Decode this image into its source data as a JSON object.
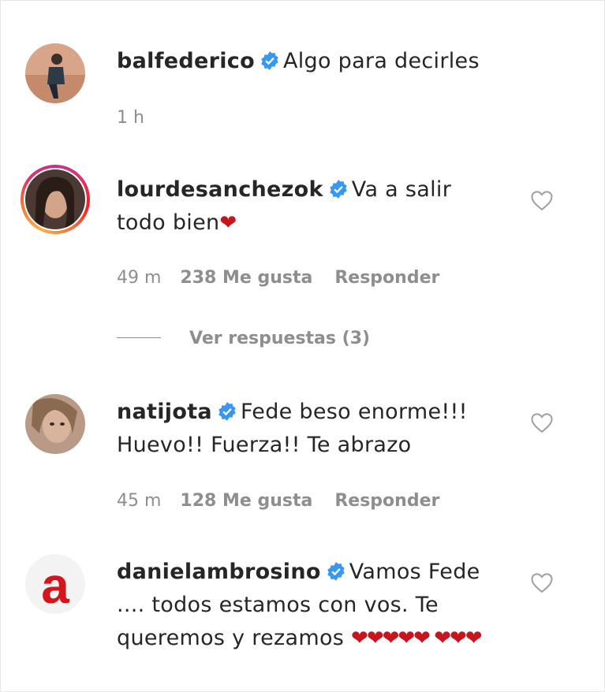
{
  "post": {
    "username": "balfederico",
    "caption": "Algo para decirles",
    "time": "1 h"
  },
  "comments": [
    {
      "username": "lourdesanchezok",
      "text": "Va a salir todo bien",
      "hearts": "❤",
      "time": "49 m",
      "likes": "238 Me gusta",
      "reply": "Responder",
      "view_replies": "Ver respuestas (3)"
    },
    {
      "username": "natijota",
      "text": "Fede beso enorme!!! Huevo!! Fuerza!! Te abrazo",
      "time": "45 m",
      "likes": "128 Me gusta",
      "reply": "Responder"
    },
    {
      "username": "danielambrosino",
      "text": "Vamos Fede .... todos estamos con vos. Te queremos y rezamos",
      "hearts": "❤❤❤❤❤ ❤❤❤",
      "avatar_letter": "a"
    }
  ],
  "colors": {
    "accent_blue": "#3897f0",
    "heart_red": "#c4161c",
    "meta_gray": "#8e8e8e"
  },
  "icons": [
    "verified-badge-icon",
    "heart-outline-icon"
  ]
}
